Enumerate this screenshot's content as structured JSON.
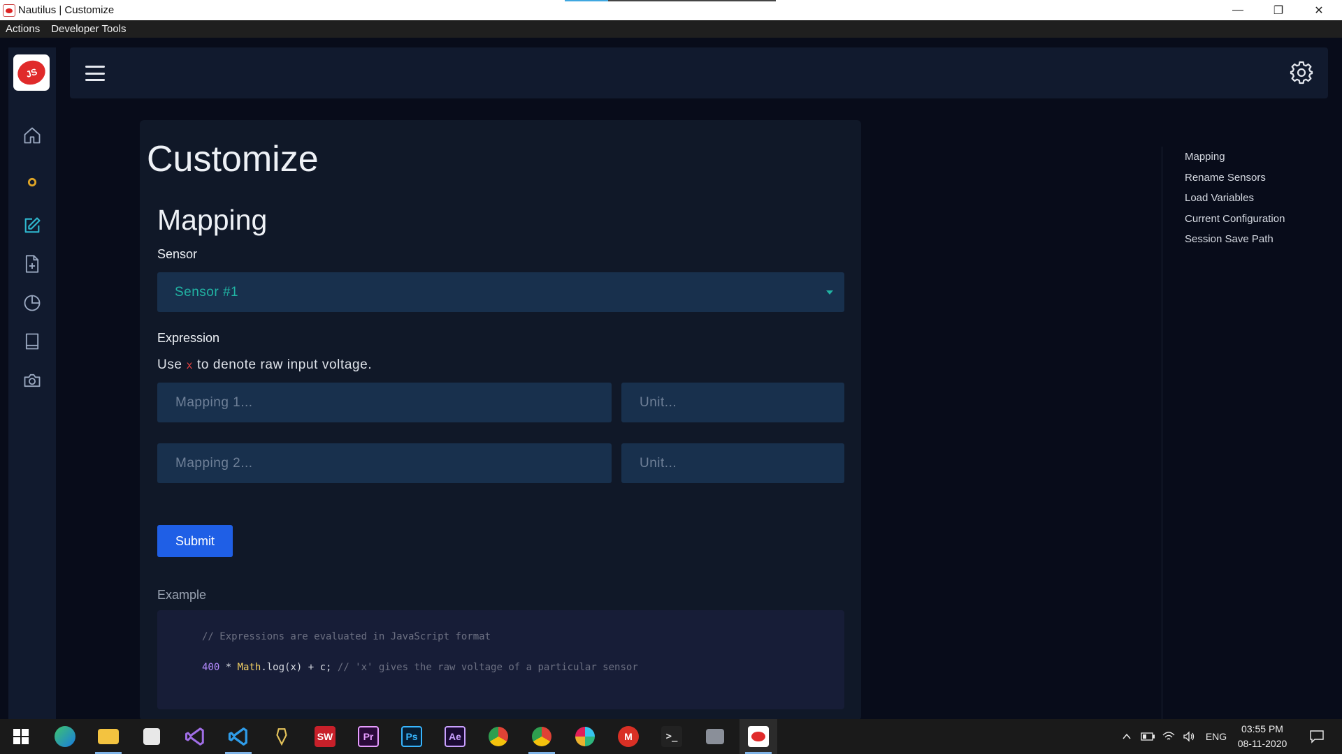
{
  "window": {
    "title": "Nautilus | Customize",
    "controls": {
      "minimize": "—",
      "restore": "❐",
      "close": "✕"
    }
  },
  "menubar": {
    "items": [
      "Actions",
      "Developer Tools"
    ]
  },
  "sidebar": {
    "logo_text": "JS",
    "items": [
      {
        "name": "home",
        "icon": "home-icon"
      },
      {
        "name": "status",
        "icon": "status-dot-icon"
      },
      {
        "name": "customize",
        "icon": "edit-icon",
        "active": true
      },
      {
        "name": "new-file",
        "icon": "file-plus-icon"
      },
      {
        "name": "charts",
        "icon": "pie-chart-icon"
      },
      {
        "name": "book",
        "icon": "book-icon"
      },
      {
        "name": "camera",
        "icon": "camera-icon"
      }
    ]
  },
  "header": {
    "menu_icon": "hamburger-icon",
    "settings_icon": "gear-icon"
  },
  "main": {
    "page_title": "Customize",
    "section_title": "Mapping",
    "sensor_label": "Sensor",
    "sensor_value": "Sensor #1",
    "expression_label": "Expression",
    "hint_before": "Use ",
    "hint_var": "x",
    "hint_after": " to denote raw input voltage.",
    "mapping1_placeholder": "Mapping 1...",
    "unit1_placeholder": "Unit...",
    "mapping2_placeholder": "Mapping 2...",
    "unit2_placeholder": "Unit...",
    "submit_label": "Submit",
    "example_label": "Example",
    "code": {
      "line1": "// Expressions are evaluated in JavaScript format",
      "num": "400",
      "op": " * ",
      "kw": "Math",
      "rest": ".log(x) + c; ",
      "comment": "// 'x' gives the raw voltage of a particular sensor"
    }
  },
  "toc": {
    "items": [
      "Mapping",
      "Rename Sensors",
      "Load Variables",
      "Current Configuration",
      "Session Save Path"
    ]
  },
  "taskbar": {
    "apps": [
      {
        "name": "start",
        "icon": "windows-start-icon"
      },
      {
        "name": "edge",
        "icon": "edge-icon"
      },
      {
        "name": "file-explorer",
        "icon": "folder-icon"
      },
      {
        "name": "store",
        "icon": "store-icon"
      },
      {
        "name": "visual-studio",
        "icon": "visual-studio-icon"
      },
      {
        "name": "vscode",
        "icon": "vscode-icon"
      },
      {
        "name": "app-7",
        "icon": "pen-icon"
      },
      {
        "name": "solidworks",
        "icon": "solidworks-icon",
        "label": "SW"
      },
      {
        "name": "premiere",
        "icon": "premiere-icon",
        "label": "Pr"
      },
      {
        "name": "photoshop",
        "icon": "photoshop-icon",
        "label": "Ps"
      },
      {
        "name": "after-effects",
        "icon": "after-effects-icon",
        "label": "Ae"
      },
      {
        "name": "chrome",
        "icon": "chrome-icon"
      },
      {
        "name": "chrome-2",
        "icon": "chrome-icon"
      },
      {
        "name": "slack",
        "icon": "slack-icon"
      },
      {
        "name": "gmail",
        "icon": "gmail-icon",
        "label": "M"
      },
      {
        "name": "terminal",
        "icon": "terminal-icon"
      },
      {
        "name": "app-17",
        "icon": "app-icon"
      },
      {
        "name": "nautilus",
        "icon": "nautilus-icon"
      }
    ],
    "tray": {
      "language": "ENG"
    },
    "clock": {
      "time": "03:55 PM",
      "date": "08-11-2020"
    }
  }
}
